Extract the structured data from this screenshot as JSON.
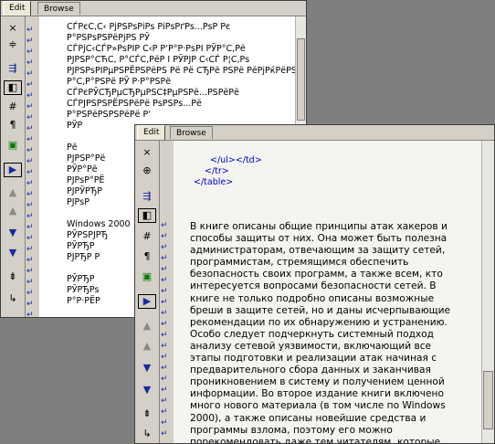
{
  "back": {
    "tabs": [
      "Edit",
      "Browse"
    ],
    "toolbar": [
      "×",
      "≑",
      "⇶",
      "◧",
      "#",
      "¶",
      "▣",
      "▶",
      "▲",
      "▲",
      "▼",
      "▼",
      "⇟",
      "↳"
    ],
    "lines": [
      "СЃРєС‚С‹ РјРЅРѕРіРѕ РіРѕРґРѕ...РѕР Рє",
      "Р°РЅРѕРЅРёРјРЅ РЎ",
      "СЃРјС‹СЃР»РѕРІР С‹Р Р‘Р°Р·РѕРІ РЎР°С‚Рё",
      "РЈРЅР°СЋС‚ Р°СЃС‚РёР І РЎРЈР С‹СЃ Р¦С‚Рѕ",
      "РЈРЅРѕРІРµРЅРЁРЅРёРЅ Рё Рё СЂРё РЅРё РёРјРќРёРЅРё",
      "Р°С‚Р°РЅРё РЎ Р·Р°РЅРё",
      "СЃРєРЎСЂРµСЂРµРЅС‡РµРЅРё...РЅРёРё",
      "СЃРЈРЅРЅРЁРЅРёРё РѕРЅРѕ...Рё",
      "Р°РЅРёРЅРЅРёРё Р‘",
      "РЎР",
      "Рё",
      "РЈРЅР°Рё",
      "РЎР°Рё",
      "РЈРѕР°РЁ",
      "РЈРЎРЂР",
      "РЈРѕР",
      "Windows 2000",
      "РЎРЅРЈРЂ",
      "РЎРЂР",
      "РЈРЂР Р",
      "РЎРЂР",
      "РЎРЂРѕ",
      "Р°Р·РЁР"
    ]
  },
  "front": {
    "tabs": [
      "Edit",
      "Browse"
    ],
    "toolbar": [
      "×",
      "⊕",
      "⇶",
      "◧",
      "#",
      "¶",
      "▣",
      "▶",
      "▲",
      "▲",
      "▼",
      "▼",
      "⇟",
      "↳",
      "⇲"
    ],
    "code": [
      "</ul></td>",
      "</tr>",
      "</table>"
    ],
    "paragraph": "В книге описаны общие принципы атак хакеров и способы защиты от них. Она может быть полезна администраторам, отвечающим за защиту сетей, программистам, стремящимся обеспечить безопасность своих программ, а также всем, кто интересуется вопросами безопасности сетей. В книге не только подробно описаны возможные бреши в защите сетей, но и даны исчерпывающие рекомендации по их обнаружению и устранению. Особо следует подчеркнуть системный подход анализу сетевой уязвимости, включающий все этапы подготовки и реализации атак начиная с предварительного сбора данных и заканчивая проникновением в систему и получением ценной информации. Во второе издание книги включено много нового материала (в том числе по Windows 2000), а также описаны новейшие средства и программы взлома, поэтому его можно порекомендовать даже тем читателям, которые знакомы с первым изданием."
  }
}
